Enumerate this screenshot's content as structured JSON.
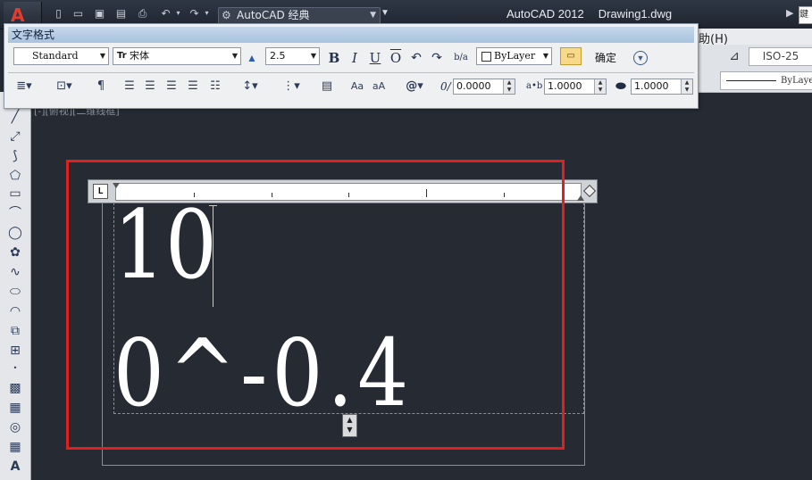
{
  "window": {
    "app_title": "AutoCAD 2012",
    "document_title": "Drawing1.dwg",
    "workspace": "AutoCAD 经典",
    "search_partial": "鍵"
  },
  "menu": {
    "help_partial": "助(H)"
  },
  "styles_toolbar": {
    "dim_style": "ISO-25"
  },
  "properties_toolbar": {
    "linetype": "ByLayer"
  },
  "viewport": {
    "label": "[-][俯视][二维线框]"
  },
  "text_format": {
    "title": "文字格式",
    "text_style": "Standard",
    "font": "宋体",
    "font_prefix": "Tr",
    "text_height": "2.5",
    "bold_label": "B",
    "italic_label": "I",
    "underline_label": "U",
    "overline_label": "O",
    "stack_label": "b/a",
    "color": "ByLayer",
    "ok_label": "确定",
    "oblique_angle": "0.0000",
    "tracking": "1.0000",
    "width_factor": "1.0000",
    "oblique_icon": "0/",
    "tracking_icon": "a•b",
    "symbol_label": "@",
    "paragraph_icon": "¶"
  },
  "editor": {
    "line1": "10",
    "line2": "0^-0.4"
  },
  "ruler": {
    "corner_label": "L"
  },
  "icons": [
    "undo-icon",
    "redo-icon",
    "ruler-icon",
    "options-icon",
    "align-left-icon",
    "align-center-icon",
    "align-right-icon",
    "justify-icon",
    "distribute-icon",
    "line-spacing-icon",
    "numbering-icon",
    "insert-field-icon",
    "uppercase-icon",
    "lowercase-icon",
    "symbol-icon",
    "columns-icon",
    "mtext-justify-icon"
  ]
}
